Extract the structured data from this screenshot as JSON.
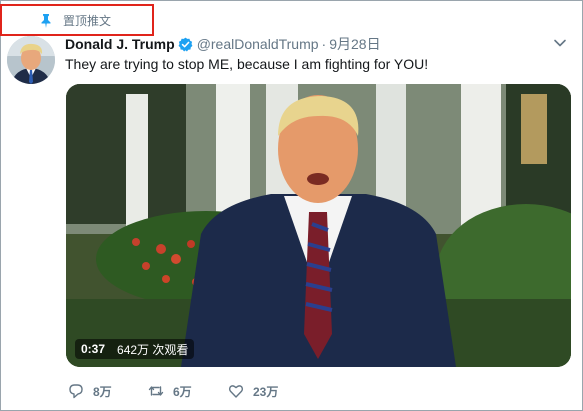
{
  "pinned": {
    "label": "置顶推文"
  },
  "tweet": {
    "author_name": "Donald J. Trump",
    "handle": "@realDonaldTrump",
    "separator": "·",
    "date": "9月28日",
    "text": "They are trying to stop ME, because I am fighting for YOU!"
  },
  "media": {
    "duration": "0:37",
    "views": "642万 次观看"
  },
  "actions": {
    "reply_count": "8万",
    "retweet_count": "6万",
    "like_count": "23万"
  },
  "colors": {
    "verified": "#1da1f2",
    "highlight_box": "#e0241b",
    "secondary_text": "#657786",
    "pin_icon": "#1da1f2"
  }
}
